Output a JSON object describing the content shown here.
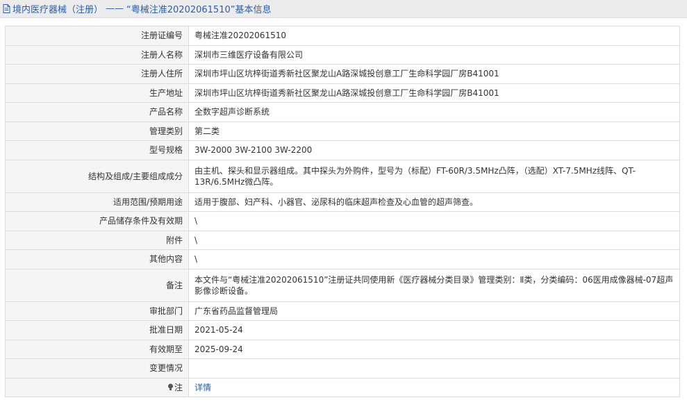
{
  "header": {
    "category": "境内医疗器械（注册）",
    "separator": "——",
    "title": "“粤械注准20202061510”基本信息"
  },
  "rows": [
    {
      "label": "注册证编号",
      "value": "粤械注准20202061510"
    },
    {
      "label": "注册人名称",
      "value": "深圳市三维医疗设备有限公司"
    },
    {
      "label": "注册人住所",
      "value": "深圳市坪山区坑梓街道秀新社区聚龙山A路深城投创意工厂生命科学园厂房B41001"
    },
    {
      "label": "生产地址",
      "value": "深圳市坪山区坑梓街道秀新社区聚龙山A路深城投创意工厂生命科学园厂房B41001"
    },
    {
      "label": "产品名称",
      "value": "全数字超声诊断系统"
    },
    {
      "label": "管理类别",
      "value": "第二类"
    },
    {
      "label": "型号规格",
      "value": "3W-2000 3W-2100 3W-2200"
    },
    {
      "label": "结构及组成/主要组成成分",
      "value": "由主机、探头和显示器组成。其中探头为外购件，型号为（标配）FT-60R/3.5MHz凸阵，（选配）XT-7.5MHz线阵、QT-13R/6.5MHz微凸阵。"
    },
    {
      "label": "适用范围/预期用途",
      "value": "适用于腹部、妇产科、小器官、泌尿科的临床超声检查及心血管的超声筛查。"
    },
    {
      "label": "产品储存条件及有效期",
      "value": "\\"
    },
    {
      "label": "附件",
      "value": "\\"
    },
    {
      "label": "其他内容",
      "value": "\\"
    },
    {
      "label": "备注",
      "value": "本文件与“粤械注准20202061510”注册证共同使用新《医疗器械分类目录》管理类别：Ⅱ类，分类编码：06医用成像器械-07超声影像诊断设备。"
    },
    {
      "label": "审批部门",
      "value": "广东省药品监督管理局"
    },
    {
      "label": "批准日期",
      "value": "2021-05-24"
    },
    {
      "label": "有效期至",
      "value": "2025-09-24"
    },
    {
      "label": "变更情况",
      "value": ""
    }
  ],
  "note": {
    "label": "注",
    "link": "详情"
  },
  "colors": {
    "link": "#2a5db0",
    "label_bg": "#f5f5f5",
    "border": "#dcdcdc"
  }
}
